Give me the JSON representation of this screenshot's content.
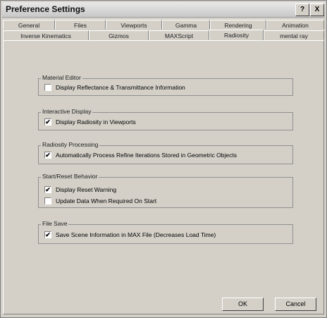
{
  "window": {
    "title": "Preference Settings",
    "help_glyph": "?",
    "close_glyph": "X"
  },
  "tabs_row1": [
    "General",
    "Files",
    "Viewports",
    "Gamma",
    "Rendering",
    "Animation"
  ],
  "tabs_row2": [
    "Inverse Kinematics",
    "Gizmos",
    "MAXScript",
    "Radiosity",
    "mental ray"
  ],
  "active_tab": "Radiosity",
  "groups": {
    "material_editor": {
      "label": "Material Editor",
      "options": [
        {
          "label": "Display Reflectance & Transmittance Information",
          "checked": false
        }
      ]
    },
    "interactive_display": {
      "label": "Interactive Display",
      "options": [
        {
          "label": "Display Radiosity in Viewports",
          "checked": true
        }
      ]
    },
    "radiosity_processing": {
      "label": "Radiosity Processing",
      "options": [
        {
          "label": "Automatically Process Refine Iterations Stored in Geometric Objects",
          "checked": true
        }
      ]
    },
    "start_reset": {
      "label": "Start/Reset Behavior",
      "options": [
        {
          "label": "Display Reset Warning",
          "checked": true
        },
        {
          "label": "Update Data When Required On Start",
          "checked": false
        }
      ]
    },
    "file_save": {
      "label": "File Save",
      "options": [
        {
          "label": "Save Scene Information in MAX File (Decreases Load Time)",
          "checked": true
        }
      ]
    }
  },
  "buttons": {
    "ok": "OK",
    "cancel": "Cancel"
  }
}
